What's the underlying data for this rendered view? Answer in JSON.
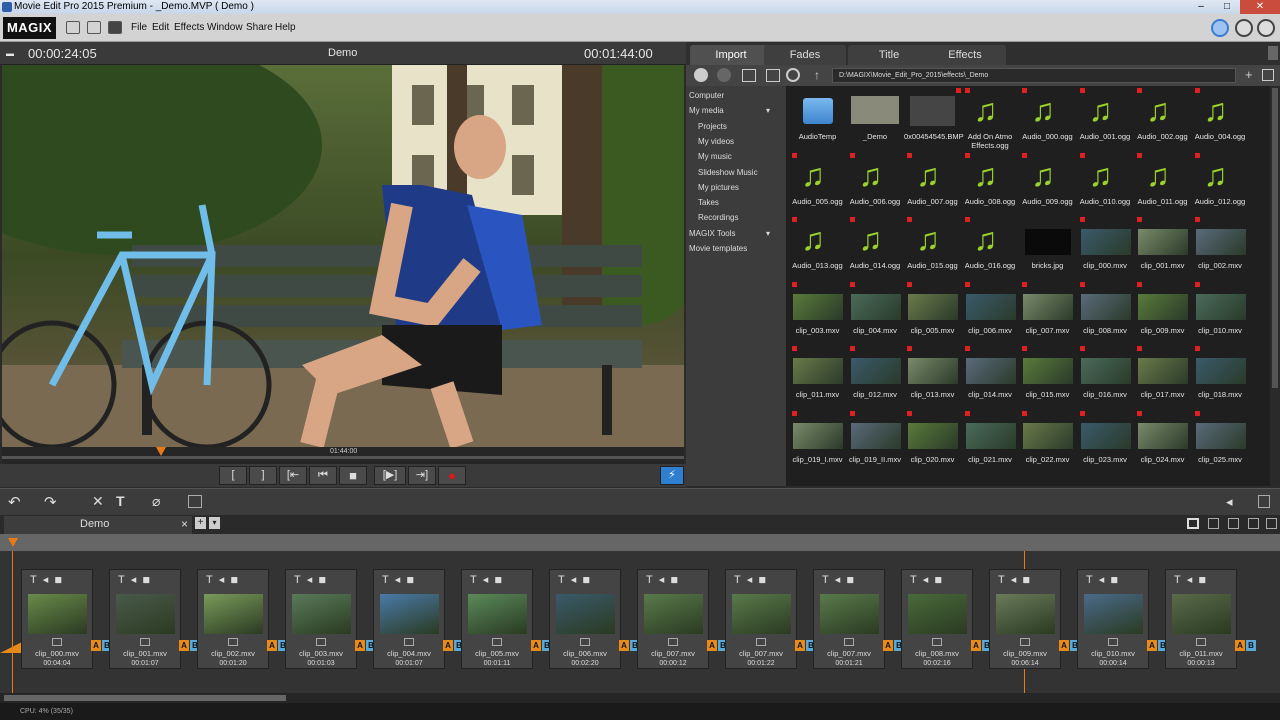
{
  "window": {
    "title": "Movie Edit Pro 2015 Premium - _Demo.MVP ( Demo )",
    "min": "–",
    "max": "□",
    "close": "✕"
  },
  "menu": {
    "logo": "MAGIX",
    "items": [
      "File",
      "Edit",
      "Effects",
      "Window",
      "Share",
      "Help"
    ]
  },
  "preview": {
    "timecode_left": "00:00:24:05",
    "project": "Demo",
    "timecode_right": "00:01:44:00",
    "scrub_time": "01:44:00"
  },
  "transport": {
    "in": "[",
    "out": "]",
    "prev_marker": "[⇤",
    "prev": "⏮",
    "stop": "■",
    "play": "[▶]",
    "next_marker": "⇥]",
    "record": "●",
    "turbo": "⚡"
  },
  "import": {
    "tabs": [
      "Import",
      "Fades",
      "Title",
      "Effects"
    ],
    "path": "D:\\MAGIX\\Movie_Edit_Pro_2015\\effects\\_Demo",
    "tree": [
      {
        "label": "Computer",
        "indent": 0
      },
      {
        "label": "My media",
        "indent": 0,
        "arrow": "▾"
      },
      {
        "label": "Projects",
        "indent": 1
      },
      {
        "label": "My videos",
        "indent": 1
      },
      {
        "label": "My music",
        "indent": 1
      },
      {
        "label": "Slideshow Music",
        "indent": 1
      },
      {
        "label": "My pictures",
        "indent": 1
      },
      {
        "label": "Takes",
        "indent": 1
      },
      {
        "label": "Recordings",
        "indent": 1
      },
      {
        "label": "MAGIX Tools",
        "indent": 0,
        "arrow": "▾"
      },
      {
        "label": "Movie templates",
        "indent": 0
      }
    ],
    "files": [
      {
        "name": "AudioTemp",
        "type": "folder"
      },
      {
        "name": "_Demo",
        "type": "project"
      },
      {
        "name": "0x00454545.BMP",
        "type": "dark"
      },
      {
        "name": "Add On Atmo Effects.ogg",
        "type": "audio"
      },
      {
        "name": "Audio_000.ogg",
        "type": "audio"
      },
      {
        "name": "Audio_001.ogg",
        "type": "audio"
      },
      {
        "name": "Audio_002.ogg",
        "type": "audio"
      },
      {
        "name": "Audio_004.ogg",
        "type": "audio"
      },
      {
        "name": "Audio_005.ogg",
        "type": "audio"
      },
      {
        "name": "Audio_006.ogg",
        "type": "audio"
      },
      {
        "name": "Audio_007.ogg",
        "type": "audio"
      },
      {
        "name": "Audio_008.ogg",
        "type": "audio"
      },
      {
        "name": "Audio_009.ogg",
        "type": "audio"
      },
      {
        "name": "Audio_010.ogg",
        "type": "audio"
      },
      {
        "name": "Audio_011.ogg",
        "type": "audio"
      },
      {
        "name": "Audio_012.ogg",
        "type": "audio"
      },
      {
        "name": "Audio_013.ogg",
        "type": "audio"
      },
      {
        "name": "Audio_014.ogg",
        "type": "audio"
      },
      {
        "name": "Audio_015.ogg",
        "type": "audio"
      },
      {
        "name": "Audio_016.ogg",
        "type": "audio"
      },
      {
        "name": "bricks.jpg",
        "type": "black"
      },
      {
        "name": "clip_000.mxv",
        "type": "video"
      },
      {
        "name": "clip_001.mxv",
        "type": "video"
      },
      {
        "name": "clip_002.mxv",
        "type": "video"
      },
      {
        "name": "clip_003.mxv",
        "type": "video"
      },
      {
        "name": "clip_004.mxv",
        "type": "video"
      },
      {
        "name": "clip_005.mxv",
        "type": "video"
      },
      {
        "name": "clip_006.mxv",
        "type": "video"
      },
      {
        "name": "clip_007.mxv",
        "type": "video"
      },
      {
        "name": "clip_008.mxv",
        "type": "video"
      },
      {
        "name": "clip_009.mxv",
        "type": "video"
      },
      {
        "name": "clip_010.mxv",
        "type": "video"
      },
      {
        "name": "clip_011.mxv",
        "type": "video"
      },
      {
        "name": "clip_012.mxv",
        "type": "video"
      },
      {
        "name": "clip_013.mxv",
        "type": "video"
      },
      {
        "name": "clip_014.mxv",
        "type": "video"
      },
      {
        "name": "clip_015.mxv",
        "type": "video"
      },
      {
        "name": "clip_016.mxv",
        "type": "video"
      },
      {
        "name": "clip_017.mxv",
        "type": "video"
      },
      {
        "name": "clip_018.mxv",
        "type": "video"
      },
      {
        "name": "clip_019_I.mxv",
        "type": "video"
      },
      {
        "name": "clip_019_II.mxv",
        "type": "video"
      },
      {
        "name": "clip_020.mxv",
        "type": "video"
      },
      {
        "name": "clip_021.mxv",
        "type": "video"
      },
      {
        "name": "clip_022.mxv",
        "type": "video"
      },
      {
        "name": "clip_023.mxv",
        "type": "video"
      },
      {
        "name": "clip_024.mxv",
        "type": "video"
      },
      {
        "name": "clip_025.mxv",
        "type": "video"
      }
    ]
  },
  "project_tab": {
    "label": "Demo",
    "close": "×",
    "add": "+",
    "menu": "▾"
  },
  "timeline": {
    "clips": [
      {
        "name": "clip_000.mxv",
        "dur": "00:04:04"
      },
      {
        "name": "clip_001.mxv",
        "dur": "00:01:07"
      },
      {
        "name": "clip_002.mxv",
        "dur": "00:01:20"
      },
      {
        "name": "clip_003.mxv",
        "dur": "00:01:03"
      },
      {
        "name": "clip_004.mxv",
        "dur": "00:01:07"
      },
      {
        "name": "clip_005.mxv",
        "dur": "00:01:11"
      },
      {
        "name": "clip_006.mxv",
        "dur": "00:02:20"
      },
      {
        "name": "clip_007.mxv",
        "dur": "00:00:12"
      },
      {
        "name": "clip_007.mxv",
        "dur": "00:01:22"
      },
      {
        "name": "clip_007.mxv",
        "dur": "00:01:21"
      },
      {
        "name": "clip_008.mxv",
        "dur": "00:02:16"
      },
      {
        "name": "clip_009.mxv",
        "dur": "00:06:14"
      },
      {
        "name": "clip_010.mxv",
        "dur": "00:00:14"
      },
      {
        "name": "clip_011.mxv",
        "dur": "00:00:13"
      }
    ],
    "clip_tools": "T◂◾",
    "a": "A",
    "b": "B"
  },
  "status": {
    "cpu": "CPU: 4% (35/35)"
  }
}
